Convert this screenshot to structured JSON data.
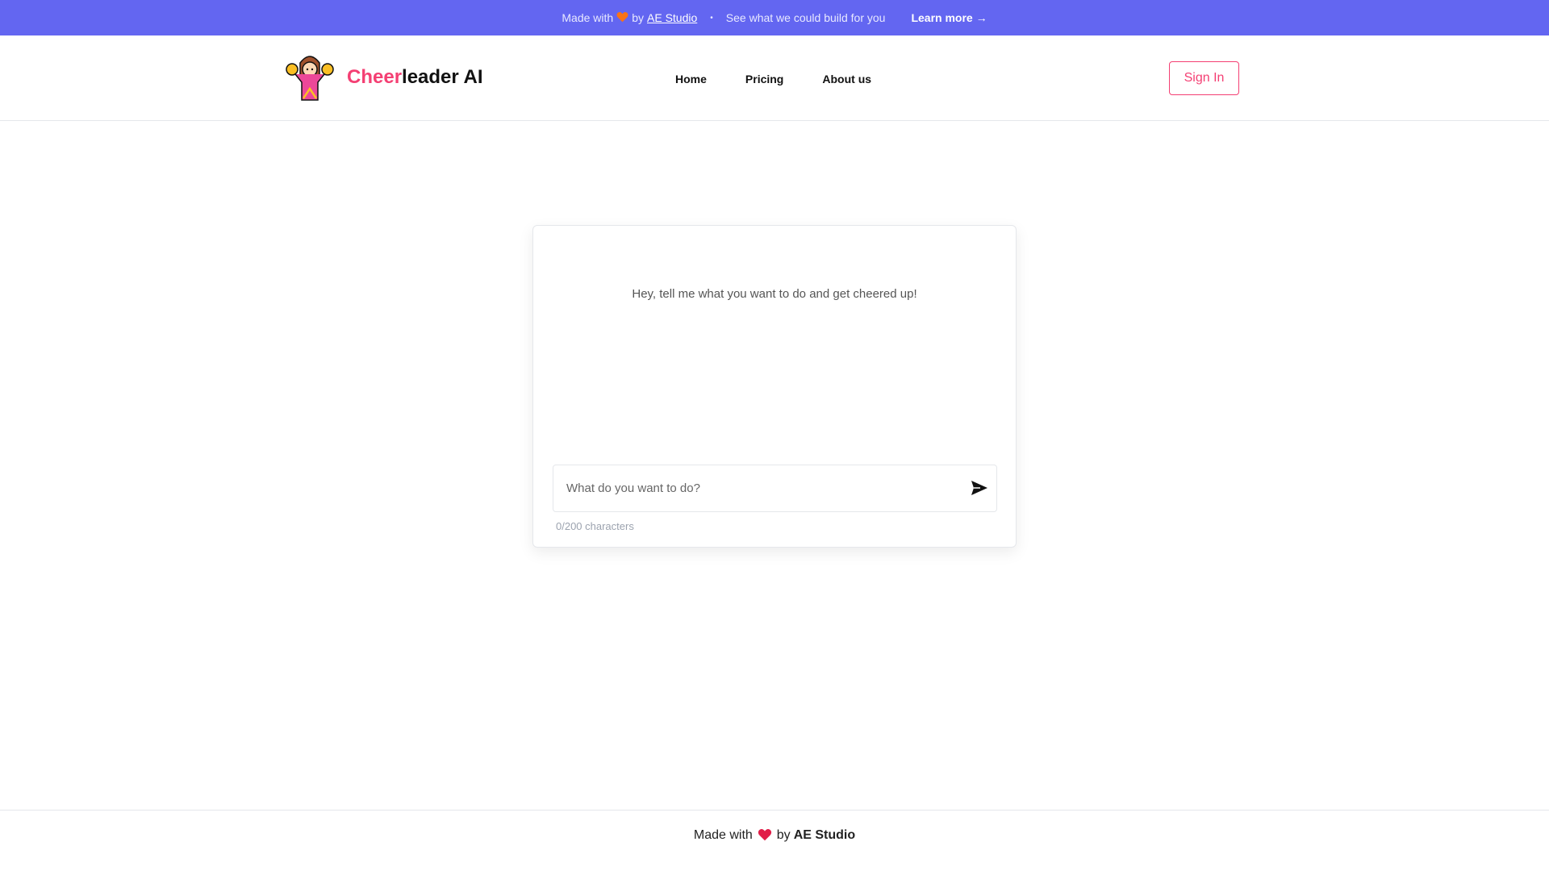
{
  "banner": {
    "made_with": "Made with",
    "by": "by",
    "studio_link": "AE Studio",
    "dot": "•",
    "tagline": "See what we could build for you",
    "learn_more": "Learn more →"
  },
  "header": {
    "brand_accent": "Cheer",
    "brand_rest": "leader AI",
    "nav": [
      "Home",
      "Pricing",
      "About us"
    ],
    "sign_in": "Sign In"
  },
  "chat": {
    "prompt": "Hey, tell me what you want to do and get cheered up!",
    "placeholder": "What do you want to do?",
    "counter": "0/200 characters"
  },
  "footer": {
    "made_with": "Made with",
    "by": "by",
    "studio": "AE Studio"
  },
  "colors": {
    "banner_bg": "#6366f1",
    "accent_pink": "#f43f73",
    "heart_orange": "#f97316",
    "heart_red": "#e11d48"
  },
  "icons": {
    "logo": "cheerleader-logo-icon",
    "heart": "heart-icon",
    "send": "send-icon"
  }
}
